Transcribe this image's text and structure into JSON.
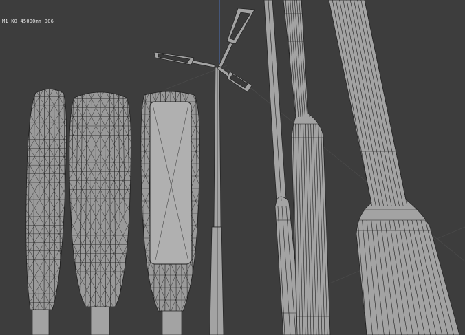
{
  "viewport": {
    "overlay_text": "M1 K0 45000mm.006",
    "background_color": "#3d3d3d",
    "mesh_color": "#9a9a9a",
    "wire_color": "#1e1e1e",
    "axis_color": "#4d6fb5"
  },
  "objects": [
    {
      "name": "bollard-light-slim"
    },
    {
      "name": "bollard-light-round"
    },
    {
      "name": "bollard-light-panel"
    },
    {
      "name": "street-lamp-three-arm"
    },
    {
      "name": "pole-thin"
    },
    {
      "name": "pole-medium"
    },
    {
      "name": "pole-thick"
    }
  ]
}
